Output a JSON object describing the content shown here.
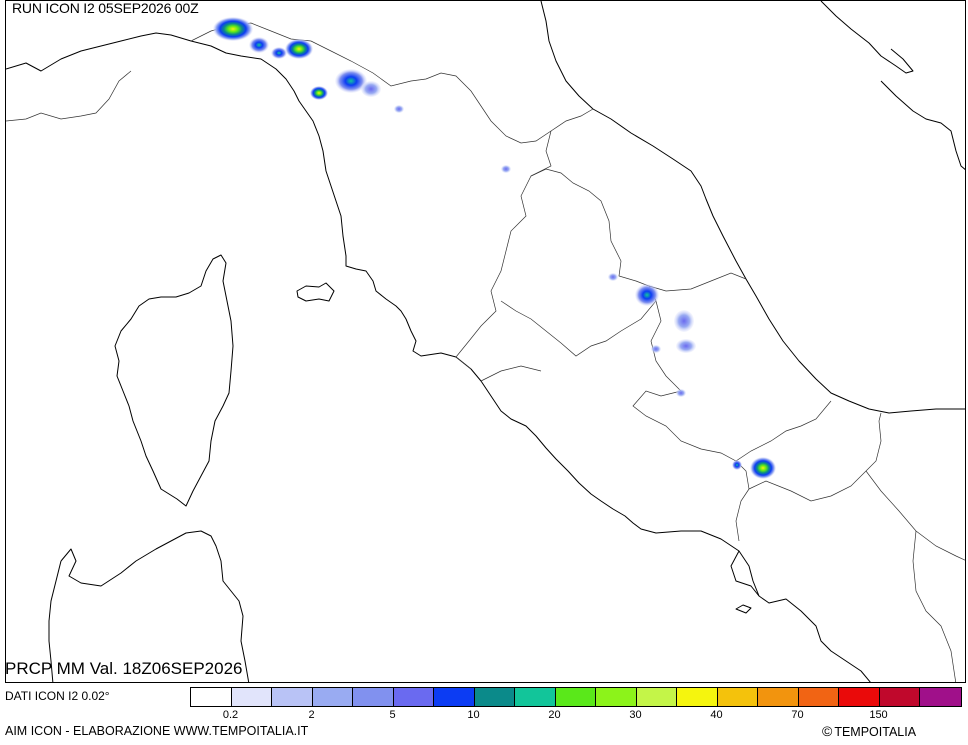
{
  "header": {
    "run_label": "RUN ICON I2 05SEP2026 00Z"
  },
  "footer": {
    "valid_label": "PRCP MM Val. 18Z06SEP2026",
    "data_source": "DATI ICON I2 0.02°",
    "credit_left": "AIM ICON - ELABORAZIONE WWW.TEMPOITALIA.IT",
    "credit_right_symbol": "©",
    "credit_right": "TEMPOITALIA"
  },
  "legend": {
    "variable": "precipitation_mm",
    "colors": [
      "#ffffff",
      "#e1e4fb",
      "#b9c3f6",
      "#99abf2",
      "#8191ef",
      "#6a6af0",
      "#0c3cf3",
      "#0b8a8a",
      "#12c59a",
      "#5ae81a",
      "#8cf31a",
      "#c4f548",
      "#f5f50e",
      "#f4c20c",
      "#f2940e",
      "#f16414",
      "#ea0a0a",
      "#c0082c",
      "#a0108a"
    ],
    "ticks": [
      "0.2",
      "2",
      "5",
      "10",
      "20",
      "30",
      "40",
      "70",
      "150"
    ]
  },
  "precip_cells": [
    {
      "id": "liguria-1",
      "level": "high"
    },
    {
      "id": "liguria-2",
      "level": "medium"
    },
    {
      "id": "liguria-3",
      "level": "medium"
    },
    {
      "id": "tuscany-coast",
      "level": "medium"
    },
    {
      "id": "umbria-marche",
      "level": "medium"
    },
    {
      "id": "abruzzo",
      "level": "low"
    },
    {
      "id": "campania-inland",
      "level": "high"
    }
  ]
}
